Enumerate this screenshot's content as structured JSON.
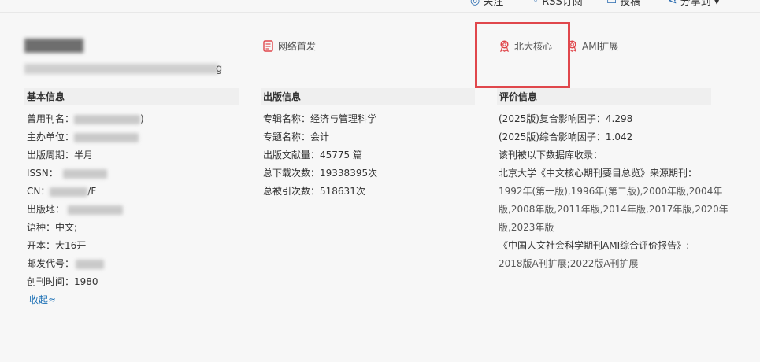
{
  "topbar": {
    "follow_label": "关注",
    "rss_label": "RSS订阅",
    "submit_label": "投稿",
    "share_label": "分享到 ▾"
  },
  "journal": {
    "tail_char": "g"
  },
  "badges": {
    "online_first": "网络首发",
    "pku_core": "北大核心",
    "ami_ext": "AMI扩展"
  },
  "basic_info": {
    "heading": "基本信息",
    "former_name_label": "曾用刊名：",
    "former_name_tail": ")",
    "sponsor_label": "主办单位：",
    "cycle_label": "出版周期：",
    "cycle_value": "半月",
    "issn_label": "ISSN：",
    "cn_label": "CN：",
    "cn_tail": "/F",
    "place_label": "出版地：",
    "language_label": "语种：",
    "language_value": "中文;",
    "format_label": "开本：",
    "format_value": "大16开",
    "postal_label": "邮发代号：",
    "founded_label": "创刊时间：",
    "founded_value": "1980",
    "collapse_label": "收起≈"
  },
  "publish_info": {
    "heading": "出版信息",
    "series_label": "专辑名称：",
    "series_value": "经济与管理科学",
    "topic_label": "专题名称：",
    "topic_value": "会计",
    "count_label": "出版文献量：",
    "count_value": "45775 篇",
    "downloads_label": "总下载次数：",
    "downloads_value": "19338395次",
    "citations_label": "总被引次数：",
    "citations_value": "518631次"
  },
  "evaluation": {
    "heading": "评价信息",
    "composite_if": "(2025版)复合影响因子：4.298",
    "comprehensive_if": "(2025版)综合影响因子：1.042",
    "indexed_by": "该刊被以下数据库收录：",
    "pku_title": "北京大学《中文核心期刊要目总览》来源期刊：",
    "pku_years_1": "1992年(第一版),1996年(第二版),2000年版,2004年",
    "pku_years_2": "版,2008年版,2011年版,2014年版,2017年版,2020年",
    "pku_years_3": "版,2023年版",
    "ami_title": "《中国人文社会科学期刊AMI综合评价报告》:",
    "ami_years": "2018版A刊扩展;2022版A刊扩展"
  },
  "colors": {
    "accent_red": "#e0474c",
    "link_blue": "#1a6fb5"
  }
}
